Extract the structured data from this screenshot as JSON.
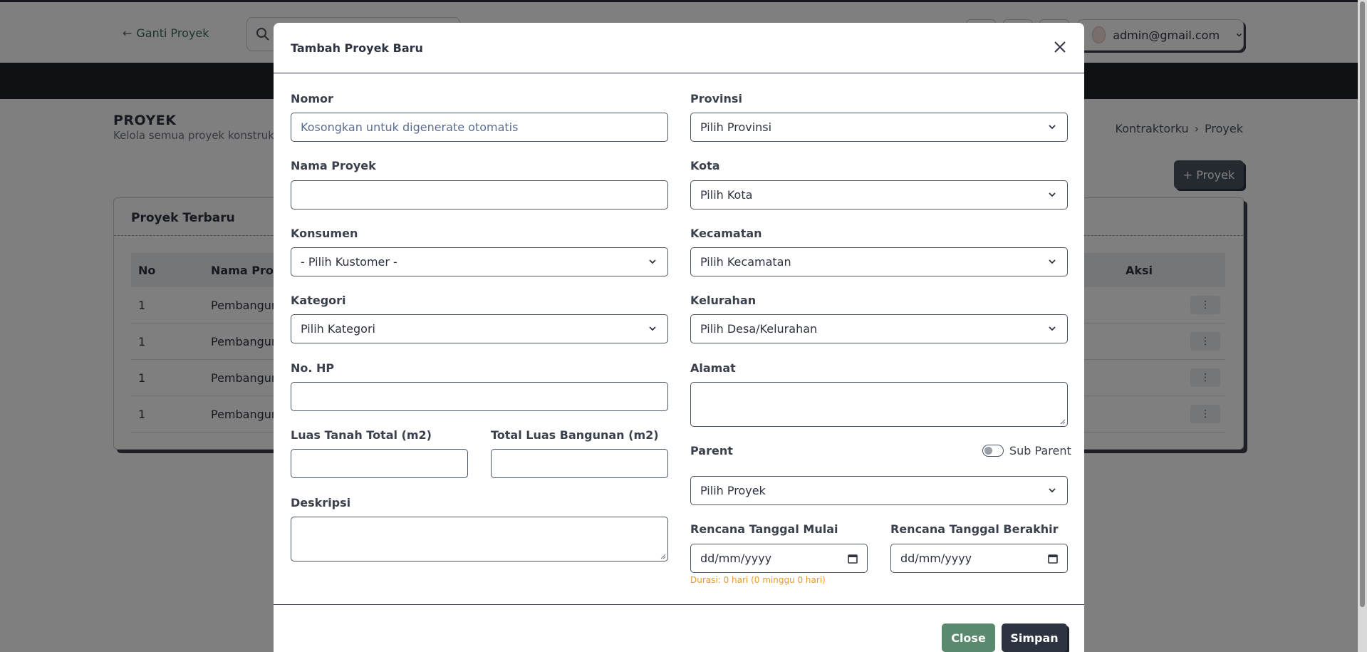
{
  "header": {
    "back_label": "Ganti Proyek",
    "user_email": "admin@gmail.com"
  },
  "page": {
    "title": "PROYEK",
    "subtitle": "Kelola semua proyek konstruksi",
    "breadcrumb": [
      "Kontraktorku",
      "Proyek"
    ],
    "add_button": "+ Proyek"
  },
  "card": {
    "title": "Proyek Terbaru",
    "columns": {
      "no": "No",
      "nama": "Nama Proyek",
      "aksi": "Aksi"
    },
    "rows": [
      {
        "no": "1",
        "nama": "Pembangunan"
      },
      {
        "no": "1",
        "nama": "Pembangunan"
      },
      {
        "no": "1",
        "nama": "Pembangunan"
      },
      {
        "no": "1",
        "nama": "Pembangunan"
      }
    ],
    "action_glyph": "⋮"
  },
  "modal": {
    "title": "Tambah Proyek Baru",
    "left": {
      "nomor_label": "Nomor",
      "nomor_placeholder": "Kosongkan untuk digenerate otomatis",
      "nama_label": "Nama Proyek",
      "konsumen_label": "Konsumen",
      "konsumen_value": "- Pilih Kustomer -",
      "kategori_label": "Kategori",
      "kategori_value": "Pilih Kategori",
      "hp_label": "No. HP",
      "luas_tanah_label": "Luas Tanah Total (m2)",
      "luas_bangunan_label": "Total Luas Bangunan (m2)",
      "deskripsi_label": "Deskripsi"
    },
    "right": {
      "provinsi_label": "Provinsi",
      "provinsi_value": "Pilih Provinsi",
      "kota_label": "Kota",
      "kota_value": "Pilih Kota",
      "kecamatan_label": "Kecamatan",
      "kecamatan_value": "Pilih Kecamatan",
      "kelurahan_label": "Kelurahan",
      "kelurahan_value": "Pilih Desa/Kelurahan",
      "alamat_label": "Alamat",
      "parent_label": "Parent",
      "sub_parent_label": "Sub Parent",
      "parent_value": "Pilih Proyek",
      "mulai_label": "Rencana Tanggal Mulai",
      "mulai_value": "dd/mm/yyyy",
      "berakhir_label": "Rencana Tanggal Berakhir",
      "berakhir_value": "dd/mm/yyyy",
      "durasi_note": "Durasi: 0 hari (0 minggu 0 hari)"
    },
    "footer": {
      "close_label": "Close",
      "save_label": "Simpan"
    }
  },
  "colors": {
    "primary_dark": "#2d3340",
    "success_green": "#5a8a6e",
    "warning_orange": "#e69a2e",
    "navbar": "#1e222b"
  },
  "icons": [
    "arrow-left-icon",
    "search-icon",
    "chevron-down-icon",
    "close-icon",
    "calendar-icon",
    "chevron-right-icon",
    "more-vertical-icon"
  ]
}
